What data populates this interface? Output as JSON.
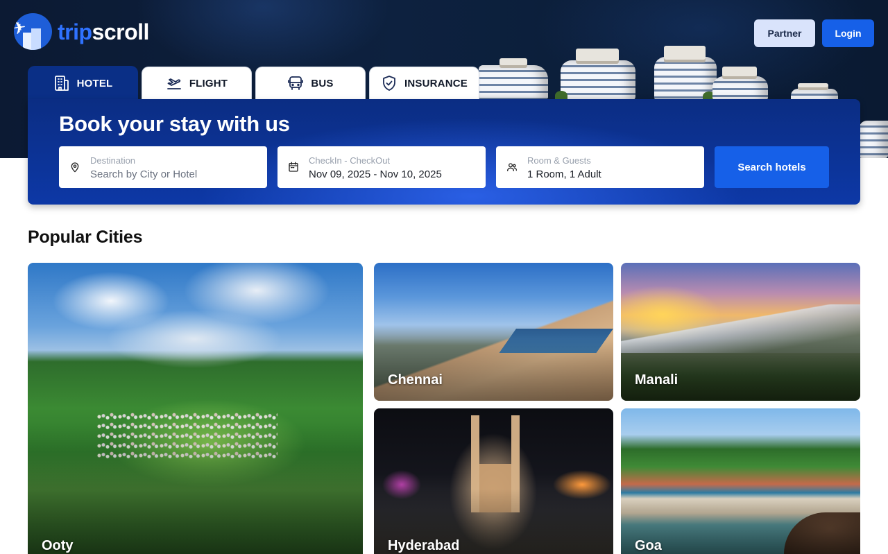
{
  "brand": {
    "name_part1": "trip",
    "name_part2": "scroll",
    "primary_color": "#1660e8",
    "dark_color": "#0a2f86"
  },
  "header": {
    "partner_label": "Partner",
    "login_label": "Login"
  },
  "tabs": [
    {
      "label": "HOTEL",
      "icon": "hotel-icon",
      "active": true
    },
    {
      "label": "FLIGHT",
      "icon": "flight-icon",
      "active": false
    },
    {
      "label": "BUS",
      "icon": "bus-icon",
      "active": false
    },
    {
      "label": "INSURANCE",
      "icon": "shield-check-icon",
      "active": false
    }
  ],
  "search": {
    "title": "Book your stay with us",
    "destination": {
      "label": "Destination",
      "placeholder": "Search by City or Hotel",
      "icon": "location-pin-icon"
    },
    "dates": {
      "label": "CheckIn - CheckOut",
      "value": "Nov 09, 2025 - Nov 10, 2025",
      "icon": "calendar-icon"
    },
    "guests": {
      "label": "Room & Guests",
      "value": "1 Room, 1 Adult",
      "icon": "users-icon"
    },
    "button_label": "Search hotels"
  },
  "popular": {
    "title": "Popular Cities",
    "cities": [
      {
        "name": "Ooty"
      },
      {
        "name": "Chennai"
      },
      {
        "name": "Manali"
      },
      {
        "name": "Hyderabad"
      },
      {
        "name": "Goa"
      }
    ]
  }
}
